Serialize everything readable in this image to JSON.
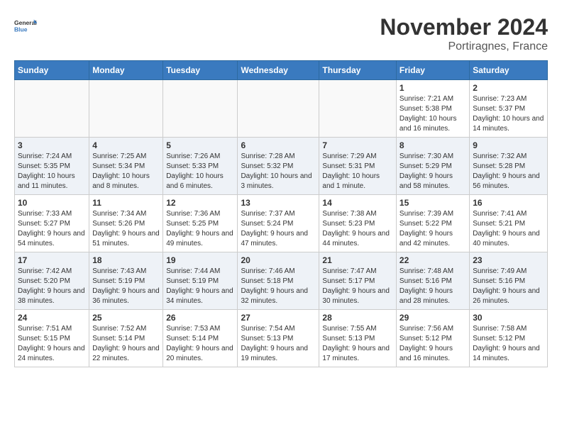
{
  "logo": {
    "line1": "General",
    "line2": "Blue"
  },
  "title": "November 2024",
  "subtitle": "Portiragnes, France",
  "days_of_week": [
    "Sunday",
    "Monday",
    "Tuesday",
    "Wednesday",
    "Thursday",
    "Friday",
    "Saturday"
  ],
  "weeks": [
    [
      {
        "day": "",
        "info": ""
      },
      {
        "day": "",
        "info": ""
      },
      {
        "day": "",
        "info": ""
      },
      {
        "day": "",
        "info": ""
      },
      {
        "day": "",
        "info": ""
      },
      {
        "day": "1",
        "info": "Sunrise: 7:21 AM\nSunset: 5:38 PM\nDaylight: 10 hours and 16 minutes."
      },
      {
        "day": "2",
        "info": "Sunrise: 7:23 AM\nSunset: 5:37 PM\nDaylight: 10 hours and 14 minutes."
      }
    ],
    [
      {
        "day": "3",
        "info": "Sunrise: 7:24 AM\nSunset: 5:35 PM\nDaylight: 10 hours and 11 minutes."
      },
      {
        "day": "4",
        "info": "Sunrise: 7:25 AM\nSunset: 5:34 PM\nDaylight: 10 hours and 8 minutes."
      },
      {
        "day": "5",
        "info": "Sunrise: 7:26 AM\nSunset: 5:33 PM\nDaylight: 10 hours and 6 minutes."
      },
      {
        "day": "6",
        "info": "Sunrise: 7:28 AM\nSunset: 5:32 PM\nDaylight: 10 hours and 3 minutes."
      },
      {
        "day": "7",
        "info": "Sunrise: 7:29 AM\nSunset: 5:31 PM\nDaylight: 10 hours and 1 minute."
      },
      {
        "day": "8",
        "info": "Sunrise: 7:30 AM\nSunset: 5:29 PM\nDaylight: 9 hours and 58 minutes."
      },
      {
        "day": "9",
        "info": "Sunrise: 7:32 AM\nSunset: 5:28 PM\nDaylight: 9 hours and 56 minutes."
      }
    ],
    [
      {
        "day": "10",
        "info": "Sunrise: 7:33 AM\nSunset: 5:27 PM\nDaylight: 9 hours and 54 minutes."
      },
      {
        "day": "11",
        "info": "Sunrise: 7:34 AM\nSunset: 5:26 PM\nDaylight: 9 hours and 51 minutes."
      },
      {
        "day": "12",
        "info": "Sunrise: 7:36 AM\nSunset: 5:25 PM\nDaylight: 9 hours and 49 minutes."
      },
      {
        "day": "13",
        "info": "Sunrise: 7:37 AM\nSunset: 5:24 PM\nDaylight: 9 hours and 47 minutes."
      },
      {
        "day": "14",
        "info": "Sunrise: 7:38 AM\nSunset: 5:23 PM\nDaylight: 9 hours and 44 minutes."
      },
      {
        "day": "15",
        "info": "Sunrise: 7:39 AM\nSunset: 5:22 PM\nDaylight: 9 hours and 42 minutes."
      },
      {
        "day": "16",
        "info": "Sunrise: 7:41 AM\nSunset: 5:21 PM\nDaylight: 9 hours and 40 minutes."
      }
    ],
    [
      {
        "day": "17",
        "info": "Sunrise: 7:42 AM\nSunset: 5:20 PM\nDaylight: 9 hours and 38 minutes."
      },
      {
        "day": "18",
        "info": "Sunrise: 7:43 AM\nSunset: 5:19 PM\nDaylight: 9 hours and 36 minutes."
      },
      {
        "day": "19",
        "info": "Sunrise: 7:44 AM\nSunset: 5:19 PM\nDaylight: 9 hours and 34 minutes."
      },
      {
        "day": "20",
        "info": "Sunrise: 7:46 AM\nSunset: 5:18 PM\nDaylight: 9 hours and 32 minutes."
      },
      {
        "day": "21",
        "info": "Sunrise: 7:47 AM\nSunset: 5:17 PM\nDaylight: 9 hours and 30 minutes."
      },
      {
        "day": "22",
        "info": "Sunrise: 7:48 AM\nSunset: 5:16 PM\nDaylight: 9 hours and 28 minutes."
      },
      {
        "day": "23",
        "info": "Sunrise: 7:49 AM\nSunset: 5:16 PM\nDaylight: 9 hours and 26 minutes."
      }
    ],
    [
      {
        "day": "24",
        "info": "Sunrise: 7:51 AM\nSunset: 5:15 PM\nDaylight: 9 hours and 24 minutes."
      },
      {
        "day": "25",
        "info": "Sunrise: 7:52 AM\nSunset: 5:14 PM\nDaylight: 9 hours and 22 minutes."
      },
      {
        "day": "26",
        "info": "Sunrise: 7:53 AM\nSunset: 5:14 PM\nDaylight: 9 hours and 20 minutes."
      },
      {
        "day": "27",
        "info": "Sunrise: 7:54 AM\nSunset: 5:13 PM\nDaylight: 9 hours and 19 minutes."
      },
      {
        "day": "28",
        "info": "Sunrise: 7:55 AM\nSunset: 5:13 PM\nDaylight: 9 hours and 17 minutes."
      },
      {
        "day": "29",
        "info": "Sunrise: 7:56 AM\nSunset: 5:12 PM\nDaylight: 9 hours and 16 minutes."
      },
      {
        "day": "30",
        "info": "Sunrise: 7:58 AM\nSunset: 5:12 PM\nDaylight: 9 hours and 14 minutes."
      }
    ]
  ]
}
